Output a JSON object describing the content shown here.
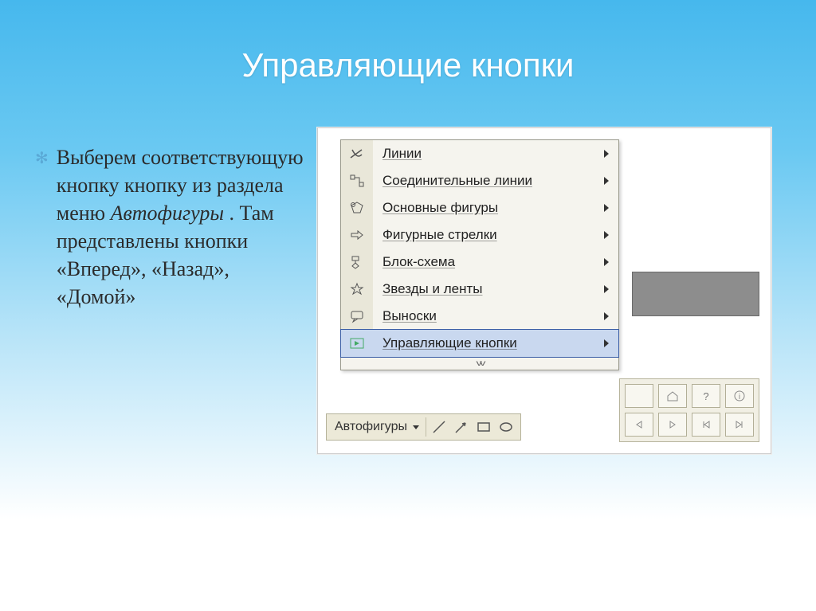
{
  "slide": {
    "title": "Управляющие кнопки",
    "body_prefix": "Выберем соответствующую кнопку кнопку из раздела меню ",
    "body_italic": "Автофигуры",
    "body_suffix": " . Там представлены кнопки «Вперед», «Назад», «Домой»"
  },
  "menu": {
    "items": [
      {
        "label": "Линии",
        "icon": "lines-icon"
      },
      {
        "label": "Соединительные линии",
        "icon": "connectors-icon"
      },
      {
        "label": "Основные фигуры",
        "icon": "basic-shapes-icon"
      },
      {
        "label": "Фигурные стрелки",
        "icon": "block-arrows-icon"
      },
      {
        "label": "Блок-схема",
        "icon": "flowchart-icon"
      },
      {
        "label": "Звезды и ленты",
        "icon": "stars-icon"
      },
      {
        "label": "Выноски",
        "icon": "callouts-icon"
      },
      {
        "label": "Управляющие кнопки",
        "icon": "action-buttons-icon",
        "highlight": true
      }
    ]
  },
  "toolbar": {
    "autoshapes_label": "Автофигуры"
  },
  "action_buttons_grid": {
    "buttons": [
      "blank",
      "home",
      "help",
      "info",
      "back",
      "forward",
      "start",
      "end"
    ]
  }
}
